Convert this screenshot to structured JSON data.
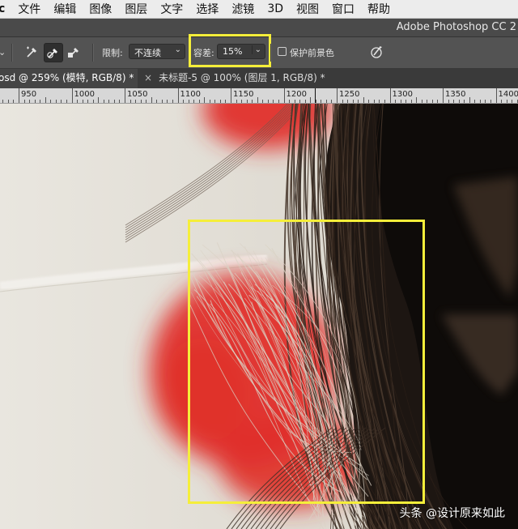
{
  "menu": {
    "app_fragment": "c",
    "items": [
      "文件",
      "编辑",
      "图像",
      "图层",
      "文字",
      "选择",
      "滤镜",
      "3D",
      "视图",
      "窗口",
      "帮助"
    ]
  },
  "window": {
    "title": "Adobe Photoshop CC 2"
  },
  "options_bar": {
    "tool_icons": [
      "sample-continuous-icon",
      "sample-once-icon",
      "sample-swatch-icon"
    ],
    "limits_label": "限制:",
    "limits_value": "不连续",
    "tolerance_label": "容差:",
    "tolerance_value": "15%",
    "protect_foreground_label": "保护前景色",
    "protect_foreground_checked": false,
    "pressure_icon": "tablet-pressure-icon",
    "highlight_color": "#f5ee3a"
  },
  "tabs": [
    {
      "label": "osd @ 259% (模特, RGB/8) *",
      "active": true
    },
    {
      "label": "未标题-5 @ 100% (图层 1, RGB/8) *",
      "active": false
    }
  ],
  "ruler": {
    "labels": [
      "950",
      "1000",
      "1050",
      "1100",
      "1150",
      "1200",
      "1250",
      "1300",
      "1350",
      "1400"
    ]
  },
  "canvas": {
    "highlight_color": "#f5ee3a",
    "mask_color": "#e0302a"
  },
  "watermark": "头条 @设计原来如此"
}
